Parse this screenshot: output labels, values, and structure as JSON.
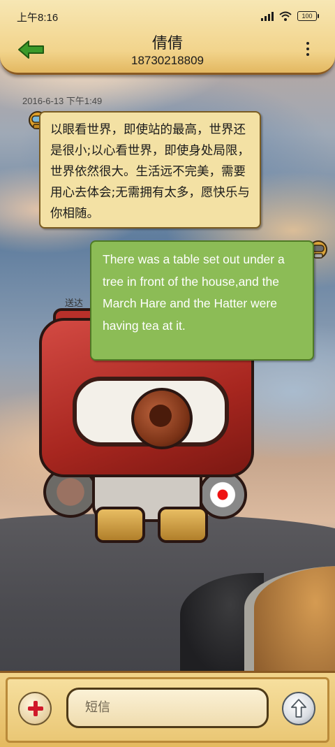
{
  "status_bar": {
    "time": "上午8:16",
    "battery": "100"
  },
  "header": {
    "contact_name": "倩倩",
    "contact_number": "18730218809",
    "back_icon": "arrow-left-icon",
    "menu_icon": "more-vertical-icon"
  },
  "messages": {
    "timestamp": "2016-6-13 下午1:49",
    "incoming": {
      "text": "以眼看世界，即使站的最高，世界还是很小;以心看世界，即使身处局限，世界依然很大。生活远不完美，需要用心去体会;无需拥有太多，愿快乐与你相随。"
    },
    "outgoing": {
      "text": "There was a table set out under a tree in front of the house,and the March Hare and the Hatter were having tea at it.",
      "status": "送达"
    }
  },
  "composer": {
    "placeholder": "短信",
    "add_icon": "plus-icon",
    "send_icon": "arrow-up-icon"
  },
  "colors": {
    "header_bg": "#f2d48c",
    "incoming_bubble": "#f3e1a4",
    "outgoing_bubble": "#8cbc56",
    "back_arrow": "#3c9a2a"
  }
}
